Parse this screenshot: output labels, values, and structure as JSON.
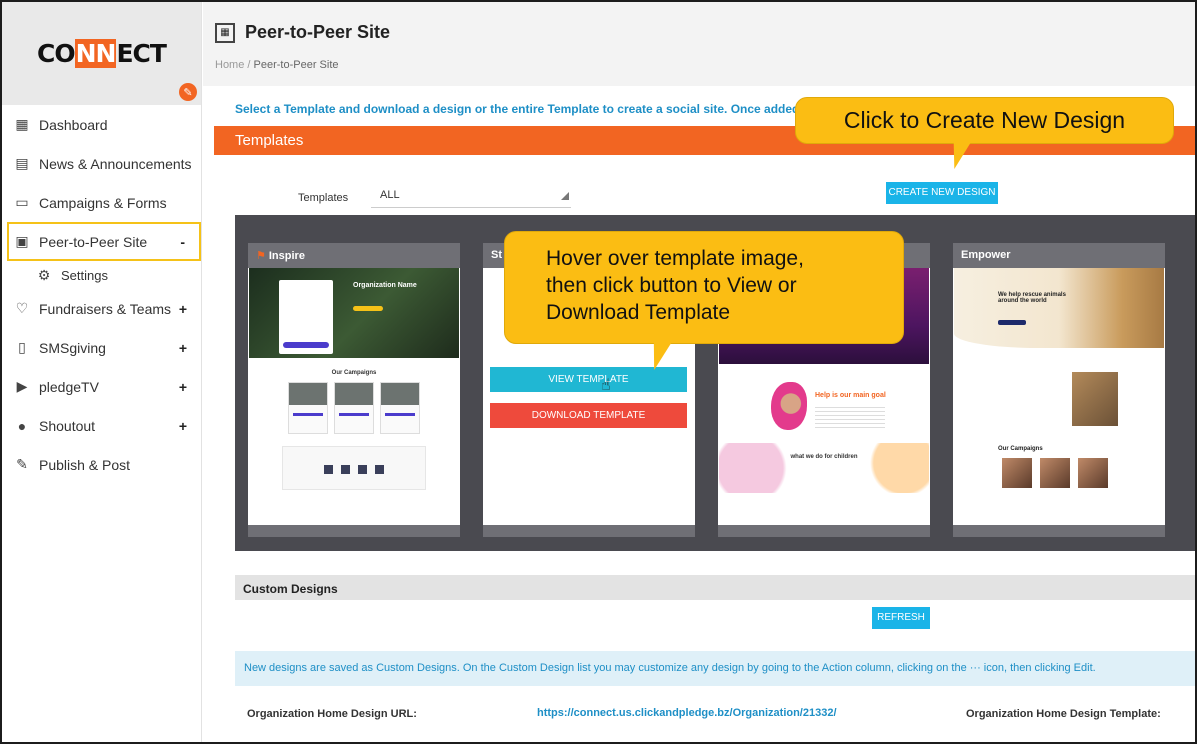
{
  "brand": {
    "logo_prefix": "CO",
    "logo_accent": "NN",
    "logo_suffix": "ECT",
    "accent_color": "#f26522"
  },
  "sidebar": {
    "items": [
      {
        "label": "Dashboard",
        "icon": "grid-icon"
      },
      {
        "label": "News & Announcements",
        "icon": "newspaper-icon"
      },
      {
        "label": "Campaigns & Forms",
        "icon": "form-icon"
      },
      {
        "label": "Peer-to-Peer Site",
        "icon": "site-icon",
        "expand": "-"
      },
      {
        "label": "Settings",
        "icon": "gear-icon"
      },
      {
        "label": "Fundraisers & Teams",
        "icon": "heart-icon",
        "expand": "+"
      },
      {
        "label": "SMSgiving",
        "icon": "phone-icon",
        "expand": "+"
      },
      {
        "label": "pledgeTV",
        "icon": "tv-icon",
        "expand": "+"
      },
      {
        "label": "Shoutout",
        "icon": "chat-icon",
        "expand": "+"
      },
      {
        "label": "Publish & Post",
        "icon": "edit-icon"
      }
    ]
  },
  "header": {
    "title": "Peer-to-Peer Site",
    "breadcrumb": {
      "home": "Home",
      "separator": "/",
      "current": "Peer-to-Peer Site"
    }
  },
  "info_text": "Select a Template and download a design or the entire Template to create a social site. Once added to your cust",
  "templates_bar": {
    "label": "Templates"
  },
  "filter": {
    "label": "Templates",
    "value": "ALL"
  },
  "buttons": {
    "create": "CREATE NEW DESIGN",
    "view": "VIEW TEMPLATE",
    "download": "DOWNLOAD TEMPLATE",
    "refresh": "REFRESH"
  },
  "templates": [
    {
      "name": "Inspire",
      "pin": "⚑"
    },
    {
      "name": "St"
    },
    {
      "name": ""
    },
    {
      "name": "Empower"
    }
  ],
  "thumbs": {
    "inspire": {
      "org": "Organization Name",
      "campaigns": "Our Campaigns"
    },
    "purple": {
      "goal": "Help is our main goal",
      "wwd": "what we do for children"
    },
    "empower": {
      "headline": "We help rescue animals around the world",
      "campaigns": "Our Campaigns"
    }
  },
  "custom_designs": {
    "title": "Custom Designs",
    "notice": "New designs are saved as Custom Designs. On the Custom Design list you may customize any design by going to the Action column, clicking on the ··· icon, then clicking Edit.",
    "url_label": "Organization Home Design URL:",
    "url_value": "https://connect.us.clickandpledge.bz/Organization/21332/",
    "template_label": "Organization Home Design Template:"
  },
  "callouts": {
    "create": "Click to Create New Design",
    "hover": {
      "line1": "Hover over template image,",
      "line2": "then click button to View or",
      "line3": "Download Template"
    }
  }
}
